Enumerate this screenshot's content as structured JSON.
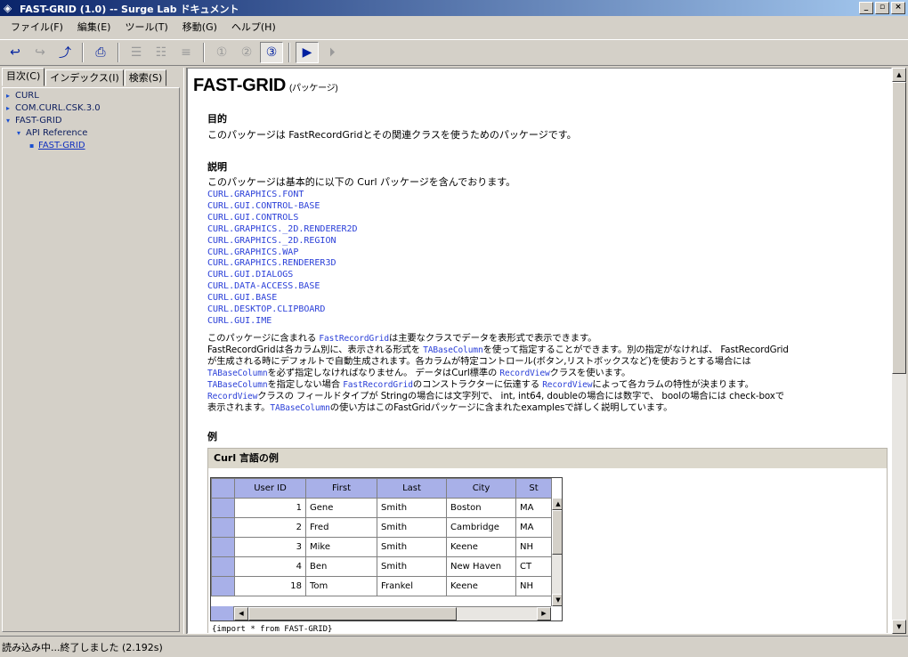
{
  "window": {
    "title": "FAST-GRID (1.0) -- Surge Lab ドキュメント",
    "buttons": [
      "_",
      "▫",
      "×"
    ]
  },
  "menu": [
    "ファイル(F)",
    "編集(E)",
    "ツール(T)",
    "移動(G)",
    "ヘルプ(H)"
  ],
  "left_pane": {
    "tabs": [
      "目次(C)",
      "インデックス(I)",
      "検索(S)"
    ],
    "tree": [
      {
        "label": "CURL",
        "level": 0,
        "arrow": "▸"
      },
      {
        "label": "COM.CURL.CSK.3.0",
        "level": 0,
        "arrow": "▸"
      },
      {
        "label": "FAST-GRID",
        "level": 0,
        "arrow": "▾"
      },
      {
        "label": "API Reference",
        "level": 1,
        "arrow": "▾"
      },
      {
        "label": "FAST-GRID",
        "level": 2,
        "arrow": "▪",
        "selected": true
      }
    ]
  },
  "content": {
    "title": "FAST-GRID",
    "title_suffix": "(パッケージ)",
    "purpose_heading": "目的",
    "purpose_text": "このパッケージは FastRecordGridとその関連クラスを使うためのパッケージです。",
    "desc_heading": "説明",
    "desc_intro": "このパッケージは基本的に以下の Curl パッケージを含んでおります。",
    "packages": [
      "CURL.GRAPHICS.FONT",
      "CURL.GUI.CONTROL-BASE",
      "CURL.GUI.CONTROLS",
      "CURL.GRAPHICS._2D.RENDERER2D",
      "CURL.GRAPHICS._2D.REGION",
      "CURL.GRAPHICS.WAP",
      "CURL.GRAPHICS.RENDERER3D",
      "CURL.GUI.DIALOGS",
      "CURL.DATA-ACCESS.BASE",
      "CURL.GUI.BASE",
      "CURL.DESKTOP.CLIPBOARD",
      "CURL.GUI.IME"
    ],
    "desc_lines": {
      "l1_a": "このパッケージに含まれる ",
      "l1_b": "FastRecordGrid",
      "l1_c": "は主要なクラスでデータを表形式で表示できます。",
      "l2_a": "FastRecordGridは各カラム別に、表示される形式を ",
      "l2_b": "TABaseColumn",
      "l2_c": "を使って指定することができます。別の指定がなければ、 FastRecordGrid",
      "l3": "が生成される時にデフォルトで自動生成されます。各カラムが特定コントロール(ボタン,リストボックスなど)を使おうとする場合には",
      "l4_a": "TABaseColumn",
      "l4_b": "を必ず指定しなければなりません。 データはCurl標準の ",
      "l4_c": "RecordView",
      "l4_d": "クラスを使います。",
      "l5_a": "TABaseColumn",
      "l5_b": "を指定しない場合 ",
      "l5_c": "FastRecordGrid",
      "l5_d": "のコンストラクターに伝達する ",
      "l5_e": "RecordView",
      "l5_f": "によって各カラムの特性が決まります。",
      "l6_a": "RecordView",
      "l6_b": "クラスの フィールドタイプが Stringの場合には文字列で、 int, int64, doubleの場合には数字で、 boolの場合には check-boxで",
      "l7_a": "表示されます。",
      "l7_b": "TABaseColumn",
      "l7_c": "の使い方はこのFastGridパッケージに含まれたexamplesで詳しく説明しています。"
    },
    "example_heading": "例",
    "example_box_title": "Curl 言語の例",
    "grid": {
      "columns": [
        "User ID",
        "First",
        "Last",
        "City",
        "St"
      ],
      "rows": [
        [
          "1",
          "Gene",
          "Smith",
          "Boston",
          "MA"
        ],
        [
          "2",
          "Fred",
          "Smith",
          "Cambridge",
          "MA"
        ],
        [
          "3",
          "Mike",
          "Smith",
          "Keene",
          "NH"
        ],
        [
          "4",
          "Ben",
          "Smith",
          "New Haven",
          "CT"
        ],
        [
          "18",
          "Tom",
          "Frankel",
          "Keene",
          "NH"
        ]
      ]
    },
    "code_line": "{import * from FAST-GRID}"
  },
  "status": "読み込み中...終了しました (2.192s)"
}
